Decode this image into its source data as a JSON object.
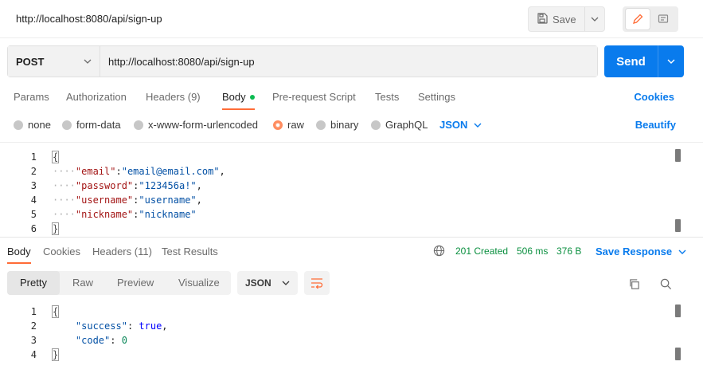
{
  "request": {
    "title": "http://localhost:8080/api/sign-up",
    "method": "POST",
    "url": "http://localhost:8080/api/sign-up",
    "save_label": "Save",
    "send_label": "Send"
  },
  "request_tabs": [
    {
      "label": "Params"
    },
    {
      "label": "Authorization"
    },
    {
      "label": "Headers (9)"
    },
    {
      "label": "Body"
    },
    {
      "label": "Pre-request Script"
    },
    {
      "label": "Tests"
    },
    {
      "label": "Settings"
    }
  ],
  "cookies_label": "Cookies",
  "body_options": [
    {
      "label": "none"
    },
    {
      "label": "form-data"
    },
    {
      "label": "x-www-form-urlencoded"
    },
    {
      "label": "raw"
    },
    {
      "label": "binary"
    },
    {
      "label": "GraphQL"
    }
  ],
  "body_type": "JSON",
  "beautify_label": "Beautify",
  "request_body": {
    "line_numbers": [
      "1",
      "2",
      "3",
      "4",
      "5",
      "6"
    ],
    "open_brace": "{",
    "close_brace": "}",
    "fields": [
      {
        "key": "\"email\"",
        "value": "\"email@email.com\"",
        "sep": ","
      },
      {
        "key": "\"password\"",
        "value": "\"123456a!\"",
        "sep": ","
      },
      {
        "key": "\"username\"",
        "value": "\"username\"",
        "sep": ","
      },
      {
        "key": "\"nickname\"",
        "value": "\"nickname\"",
        "sep": ""
      }
    ]
  },
  "response_tabs": [
    {
      "label": "Body"
    },
    {
      "label": "Cookies"
    },
    {
      "label": "Headers (11)"
    },
    {
      "label": "Test Results"
    }
  ],
  "response_meta": {
    "status": "201 Created",
    "time": "506 ms",
    "size": "376 B",
    "save_response_label": "Save Response"
  },
  "format_tabs": [
    {
      "label": "Pretty"
    },
    {
      "label": "Raw"
    },
    {
      "label": "Preview"
    },
    {
      "label": "Visualize"
    }
  ],
  "response_format": "JSON",
  "response_body": {
    "line_numbers": [
      "1",
      "2",
      "3",
      "4"
    ],
    "open_brace": "{",
    "close_brace": "}",
    "fields": [
      {
        "key": "\"success\"",
        "value": "true",
        "sep": ","
      },
      {
        "key": "\"code\"",
        "value": "0",
        "sep": ""
      }
    ]
  },
  "colors": {
    "accent": "#ff6c37",
    "primary": "#097bed",
    "status_ok": "#0cbb52"
  }
}
